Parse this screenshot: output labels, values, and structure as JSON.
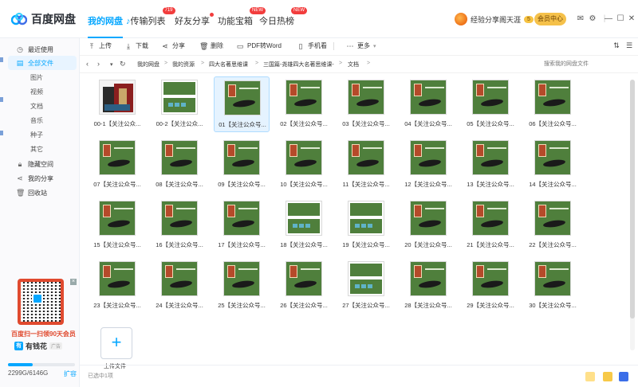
{
  "app": {
    "name": "百度网盘"
  },
  "nav_tabs": [
    {
      "label": "我的网盘",
      "active": true,
      "badge": ""
    },
    {
      "label": "传输列表",
      "active": false,
      "badge": "719"
    },
    {
      "label": "好友分享",
      "active": false,
      "badge": ""
    },
    {
      "label": "功能宝箱",
      "active": false,
      "badge": "NEW"
    },
    {
      "label": "今日热榜",
      "active": false,
      "badge": "NEW"
    }
  ],
  "user": {
    "name": "经验分享阁天涯",
    "level": "5",
    "vip_button": "会员中心"
  },
  "sidebar": {
    "items": [
      {
        "label": "最近使用",
        "icon": "clock-icon",
        "sub": false,
        "active": false
      },
      {
        "label": "全部文件",
        "icon": "file-icon",
        "sub": false,
        "active": true
      },
      {
        "label": "图片",
        "icon": "",
        "sub": true,
        "active": false
      },
      {
        "label": "视频",
        "icon": "",
        "sub": true,
        "active": false
      },
      {
        "label": "文档",
        "icon": "",
        "sub": true,
        "active": false
      },
      {
        "label": "音乐",
        "icon": "",
        "sub": true,
        "active": false
      },
      {
        "label": "种子",
        "icon": "",
        "sub": true,
        "active": false
      },
      {
        "label": "其它",
        "icon": "",
        "sub": true,
        "active": false
      },
      {
        "label": "隐藏空间",
        "icon": "lock-icon",
        "sub": false,
        "active": false
      },
      {
        "label": "我的分享",
        "icon": "share-icon",
        "sub": false,
        "active": false
      },
      {
        "label": "回收站",
        "icon": "trash-icon",
        "sub": false,
        "active": false
      }
    ],
    "promo_text": "百度扫一扫领90天会员",
    "promo_brand": "有钱花",
    "promo_tag": "广告",
    "storage_used": "2299G",
    "storage_total": "6146G",
    "storage_label": "2299G/6146G",
    "storage_fraction": 0.374,
    "expand_label": "扩容"
  },
  "toolbar": {
    "upload": "上传",
    "download": "下载",
    "share": "分享",
    "delete": "删除",
    "pdf_to_word": "PDF转Word",
    "phone_view": "手机看",
    "more": "更多"
  },
  "breadcrumb": [
    "我的网盘",
    "我的资源",
    "四大名著思维课",
    "三国篇-尧雄四大名著思维课-",
    "文档"
  ],
  "search_placeholder": "搜索我的网盘文件",
  "files": [
    {
      "label": "00-1【关注公众...",
      "thumb": "books",
      "selected": false
    },
    {
      "label": "00-2【关注公众...",
      "thumb": "white",
      "selected": false
    },
    {
      "label": "01【关注公众号...",
      "thumb": "green",
      "selected": true
    },
    {
      "label": "02【关注公众号...",
      "thumb": "green",
      "selected": false
    },
    {
      "label": "03【关注公众号...",
      "thumb": "green",
      "selected": false
    },
    {
      "label": "04【关注公众号...",
      "thumb": "green",
      "selected": false
    },
    {
      "label": "05【关注公众号...",
      "thumb": "green",
      "selected": false
    },
    {
      "label": "06【关注公众号...",
      "thumb": "green",
      "selected": false
    },
    {
      "label": "07【关注公众号...",
      "thumb": "green",
      "selected": false
    },
    {
      "label": "08【关注公众号...",
      "thumb": "green",
      "selected": false
    },
    {
      "label": "09【关注公众号...",
      "thumb": "green",
      "selected": false
    },
    {
      "label": "10【关注公众号...",
      "thumb": "green",
      "selected": false
    },
    {
      "label": "11【关注公众号...",
      "thumb": "green",
      "selected": false
    },
    {
      "label": "12【关注公众号...",
      "thumb": "green",
      "selected": false
    },
    {
      "label": "13【关注公众号...",
      "thumb": "green",
      "selected": false
    },
    {
      "label": "14【关注公众号...",
      "thumb": "green",
      "selected": false
    },
    {
      "label": "15【关注公众号...",
      "thumb": "green",
      "selected": false
    },
    {
      "label": "16【关注公众号...",
      "thumb": "green",
      "selected": false
    },
    {
      "label": "17【关注公众号...",
      "thumb": "green",
      "selected": false
    },
    {
      "label": "18【关注公众号...",
      "thumb": "white",
      "selected": false
    },
    {
      "label": "19【关注公众号...",
      "thumb": "white",
      "selected": false
    },
    {
      "label": "20【关注公众号...",
      "thumb": "green",
      "selected": false
    },
    {
      "label": "21【关注公众号...",
      "thumb": "green",
      "selected": false
    },
    {
      "label": "22【关注公众号...",
      "thumb": "green",
      "selected": false
    },
    {
      "label": "23【关注公众号...",
      "thumb": "green",
      "selected": false
    },
    {
      "label": "24【关注公众号...",
      "thumb": "green",
      "selected": false
    },
    {
      "label": "25【关注公众号...",
      "thumb": "green",
      "selected": false
    },
    {
      "label": "26【关注公众号...",
      "thumb": "green",
      "selected": false
    },
    {
      "label": "27【关注公众号...",
      "thumb": "white",
      "selected": false
    },
    {
      "label": "28【关注公众号...",
      "thumb": "green",
      "selected": false
    },
    {
      "label": "29【关注公众号...",
      "thumb": "green",
      "selected": false
    },
    {
      "label": "30【关注公众号...",
      "thumb": "green",
      "selected": false
    }
  ],
  "upload_tile_label": "上传文件",
  "status": {
    "selected_text": "已选中1项"
  },
  "colors": {
    "accent": "#06a7ff",
    "thumb_green": "#4f7f3c",
    "badge_red": "#f23d3d"
  }
}
